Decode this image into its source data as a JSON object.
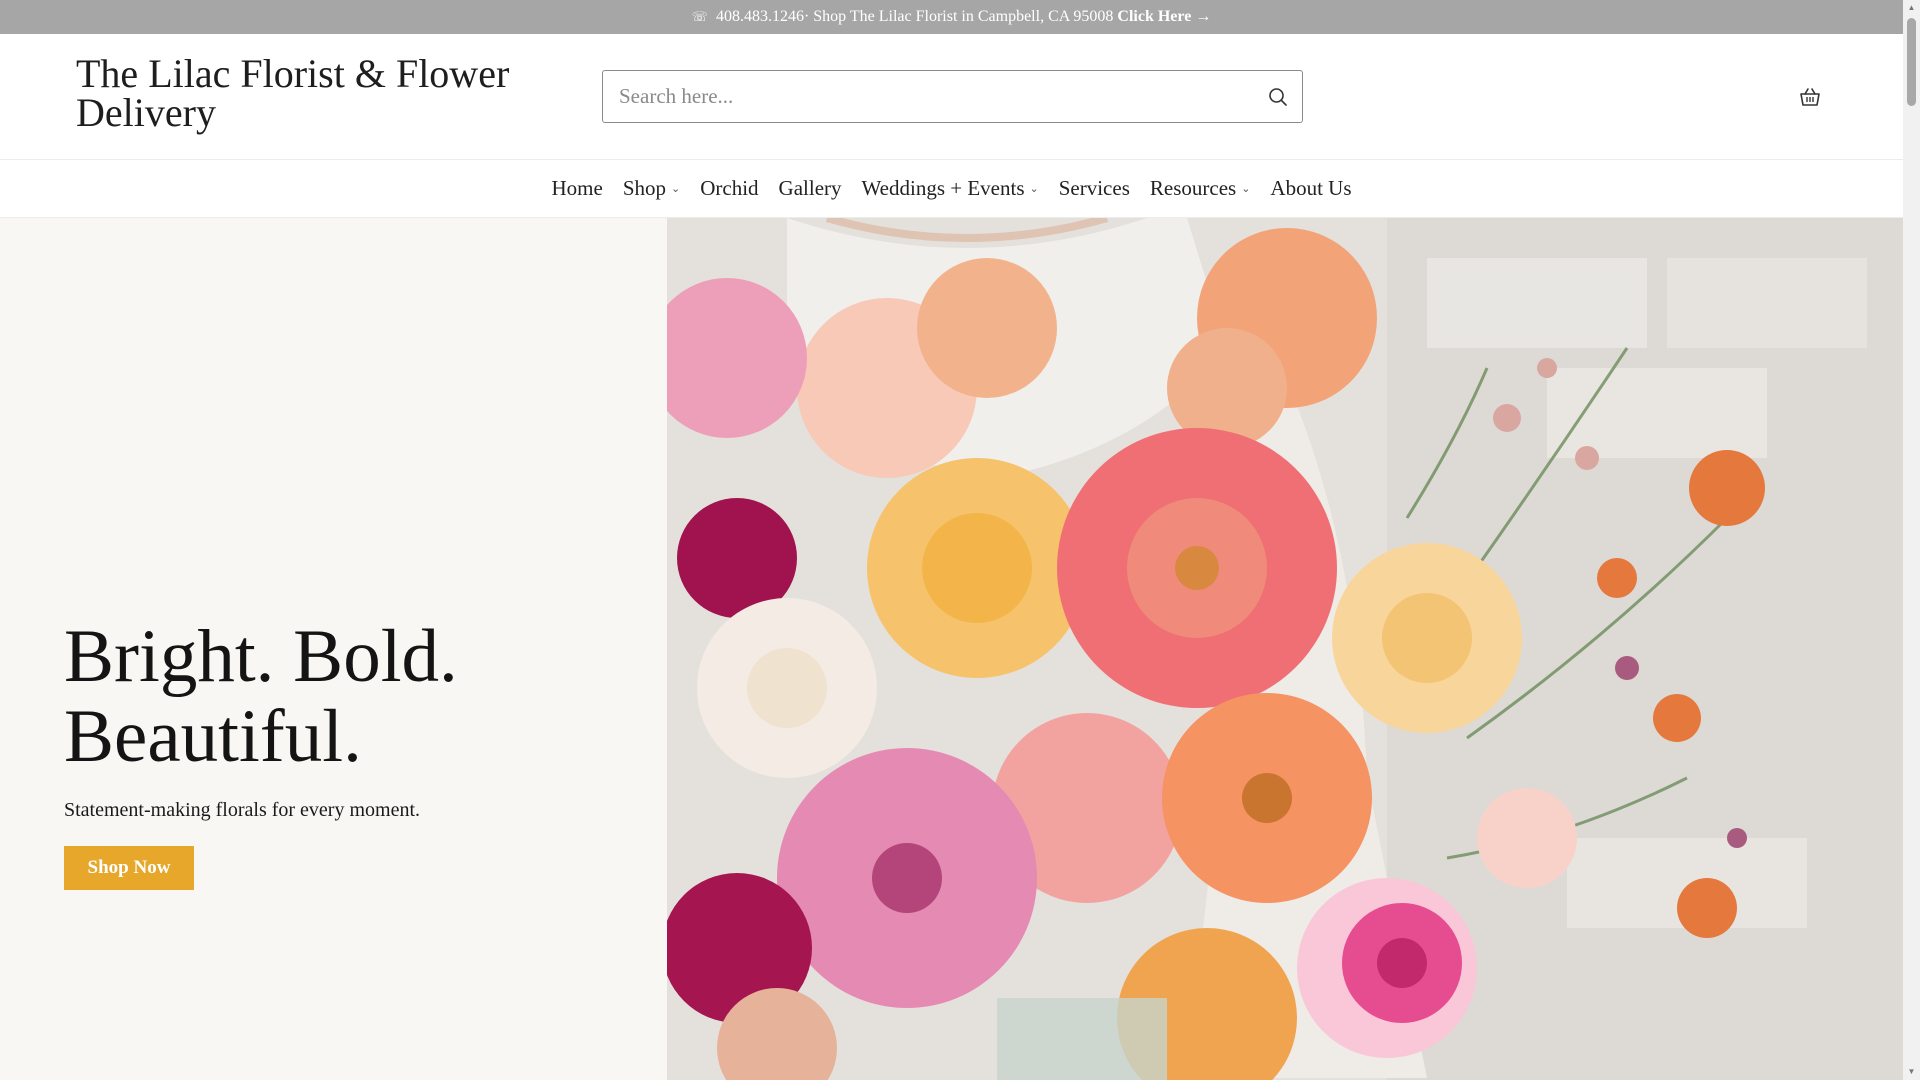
{
  "announcement": {
    "phone_icon": "phone-icon",
    "text": "408.483.1246· Shop The Lilac Florist in Campbell, CA 95008",
    "link": "Click Here →"
  },
  "header": {
    "logo": "The Lilac Florist & Flower Delivery",
    "search_placeholder": "Search here...",
    "search_icon": "search-icon",
    "cart_icon": "basket-icon"
  },
  "nav": {
    "items": [
      {
        "label": "Home",
        "dropdown": false
      },
      {
        "label": "Shop",
        "dropdown": true
      },
      {
        "label": "Orchid",
        "dropdown": false
      },
      {
        "label": "Gallery",
        "dropdown": false
      },
      {
        "label": "Weddings + Events",
        "dropdown": true
      },
      {
        "label": "Services",
        "dropdown": false
      },
      {
        "label": "Resources",
        "dropdown": true
      },
      {
        "label": "About Us",
        "dropdown": false
      }
    ]
  },
  "hero": {
    "title_line1": "Bright. Bold.",
    "title_line2": "Beautiful.",
    "subtitle": "Statement-making florals for every moment.",
    "cta": "Shop Now",
    "image": "flower-bouquet-photo"
  },
  "colors": {
    "announcement_bg": "#a6a6a6",
    "cta_bg": "#e6a72b",
    "hero_left_bg": "#f8f7f4"
  }
}
